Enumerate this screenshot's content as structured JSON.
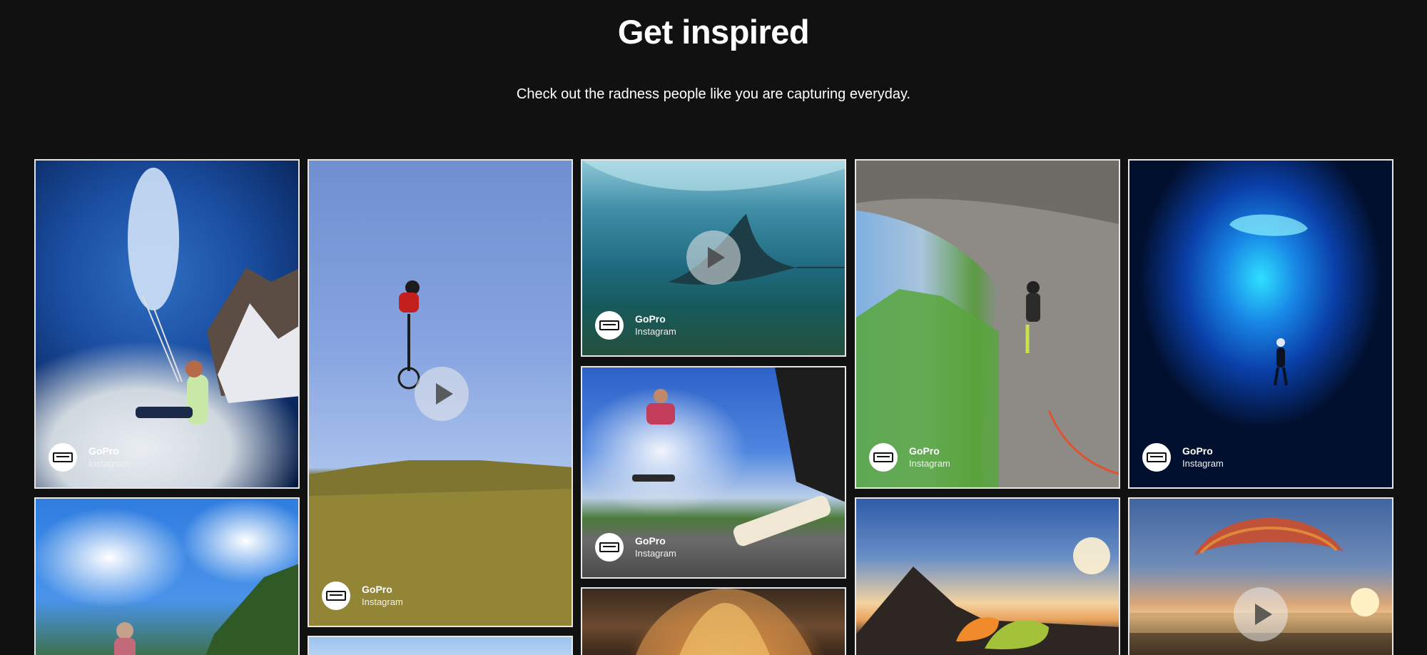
{
  "header": {
    "title": "Get inspired",
    "subtitle": "Check out the radness people like you are capturing everyday."
  },
  "tiles": [
    {
      "id": "paraglider-alps",
      "scene": "paragliding above clouds",
      "credit_name": "GoPro",
      "credit_source": "Instagram",
      "is_video": false
    },
    {
      "id": "bmx-jump",
      "scene": "bmx jump over grass",
      "credit_name": "GoPro",
      "credit_source": "Instagram",
      "is_video": true
    },
    {
      "id": "manta-ray",
      "scene": "manta ray underwater",
      "credit_name": "GoPro",
      "credit_source": "Instagram",
      "is_video": true
    },
    {
      "id": "skateboard-jump",
      "scene": "skateboarder jumping",
      "credit_name": "GoPro",
      "credit_source": "Instagram",
      "is_video": false
    },
    {
      "id": "rock-climber",
      "scene": "climber on cliff",
      "credit_name": "GoPro",
      "credit_source": "Instagram",
      "is_video": false
    },
    {
      "id": "cave-diver",
      "scene": "diver in blue cave",
      "credit_name": "GoPro",
      "credit_source": "Instagram",
      "is_video": false
    },
    {
      "id": "clouds-person",
      "scene": "person under cloudy sky",
      "is_video": false
    },
    {
      "id": "sky-strip",
      "scene": "sky",
      "is_video": false
    },
    {
      "id": "hot-air-balloon",
      "scene": "inside hot air balloon",
      "is_video": false
    },
    {
      "id": "mountain-sunset",
      "scene": "tents on mountain at sunset",
      "is_video": false
    },
    {
      "id": "paraglider-sunset",
      "scene": "paraglider over lake at sunset",
      "is_video": true
    }
  ],
  "colors": {
    "background": "#111111",
    "tile_border": "#e6e6e6",
    "text": "#ffffff"
  },
  "icons": {
    "play": "play-icon",
    "avatar": "gopro-logo-icon"
  }
}
